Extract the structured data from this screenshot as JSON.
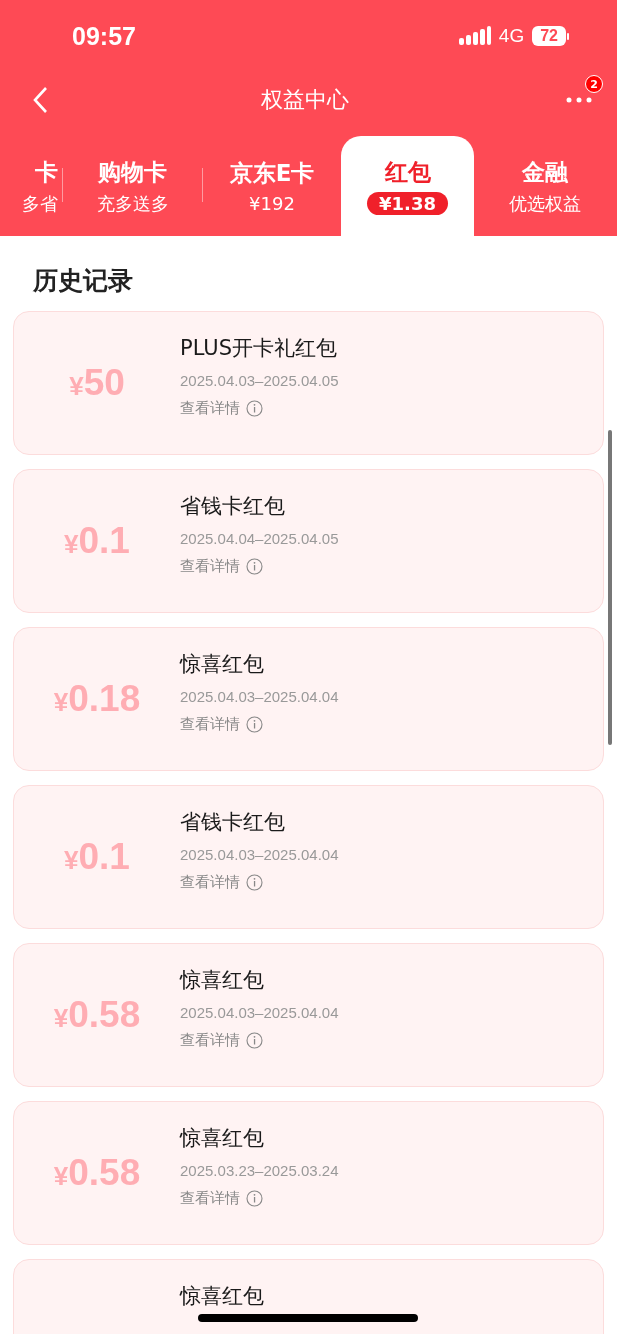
{
  "status_bar": {
    "time": "09:57",
    "network": "4G",
    "battery": "72"
  },
  "nav": {
    "title": "权益中心",
    "badge": "2"
  },
  "tabs": [
    {
      "title": "卡",
      "subtitle": "多省",
      "selected": false
    },
    {
      "title": "购物卡",
      "subtitle": "充多送多",
      "selected": false
    },
    {
      "title": "京东E卡",
      "subtitle": "¥192",
      "selected": false
    },
    {
      "title": "红包",
      "subtitle": "¥1.38",
      "selected": true
    },
    {
      "title": "金融",
      "subtitle": "优选权益",
      "selected": false
    }
  ],
  "section_title": "历史记录",
  "records": [
    {
      "currency": "¥",
      "amount": "50",
      "title": "PLUS开卡礼红包",
      "period": "2025.04.03–2025.04.05",
      "details": "查看详情"
    },
    {
      "currency": "¥",
      "amount": "0.1",
      "title": "省钱卡红包",
      "period": "2025.04.04–2025.04.05",
      "details": "查看详情"
    },
    {
      "currency": "¥",
      "amount": "0.18",
      "title": "惊喜红包",
      "period": "2025.04.03–2025.04.04",
      "details": "查看详情"
    },
    {
      "currency": "¥",
      "amount": "0.1",
      "title": "省钱卡红包",
      "period": "2025.04.03–2025.04.04",
      "details": "查看详情"
    },
    {
      "currency": "¥",
      "amount": "0.58",
      "title": "惊喜红包",
      "period": "2025.04.03–2025.04.04",
      "details": "查看详情"
    },
    {
      "currency": "¥",
      "amount": "0.58",
      "title": "惊喜红包",
      "period": "2025.03.23–2025.03.24",
      "details": "查看详情"
    },
    {
      "title": "惊喜红包"
    }
  ]
}
